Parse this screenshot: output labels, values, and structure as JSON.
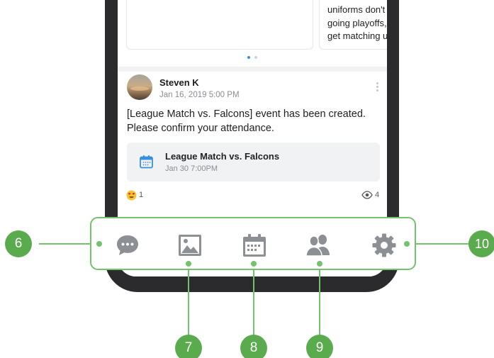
{
  "carousel": {
    "right_card_lines": [
      "uniforms don't",
      "going playoffs,",
      "get matching u"
    ],
    "page_count": 2,
    "active_page": 1
  },
  "post": {
    "author": "Steven K",
    "date": "Jan 16, 2019 5:00 PM",
    "text": "[League Match vs. Falcons] event has been created. Please confirm your attendance.",
    "event": {
      "title": "League Match vs. Falcons",
      "date": "Jan 30 7:00PM"
    },
    "reaction_icon": "heart-eyes-emoji",
    "reaction_count": "1",
    "view_icon": "eye-icon",
    "view_count": "4"
  },
  "tabbar": {
    "tabs": [
      {
        "name": "messages",
        "icon": "chat-bubble-icon"
      },
      {
        "name": "photos",
        "icon": "image-icon"
      },
      {
        "name": "schedule",
        "icon": "calendar-icon"
      },
      {
        "name": "members",
        "icon": "people-icon"
      },
      {
        "name": "settings",
        "icon": "gear-icon"
      }
    ]
  },
  "callouts": [
    "6",
    "7",
    "8",
    "9",
    "10"
  ],
  "colors": {
    "callout_green": "#72c26e",
    "badge_green": "#5aab4d",
    "icon_gray": "#8c8f94",
    "accent_blue": "#3a8fdc",
    "phone_frame": "#2b2b2d"
  }
}
